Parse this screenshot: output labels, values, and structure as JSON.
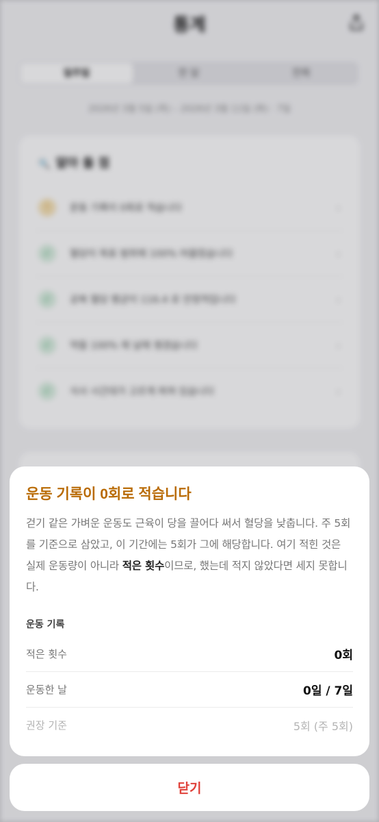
{
  "background": {
    "title": "통계",
    "tabs": [
      "일주일",
      "한 달",
      "전체"
    ],
    "date_range": "2026년 3월 5일 (목) – 2026년 3월 11일 (화) · 7일",
    "card_title": "알아 둘 점",
    "items": [
      {
        "icon": "warning-icon",
        "text": "운동 기록이 0회로 적습니다"
      },
      {
        "icon": "check-icon",
        "text": "혈당이 목표 범위에 100% 머물렀습니다"
      },
      {
        "icon": "check-icon",
        "text": "공복 혈당 평균이 116.4 로 안정적입니다"
      },
      {
        "icon": "check-icon",
        "text": "약을 100% 제 날에 챙겼습니다"
      },
      {
        "icon": "check-icon",
        "text": "식사 시간대가 고르게 퍼져 있습니다"
      }
    ]
  },
  "sheet": {
    "title": "운동 기록이 0회로 적습니다",
    "desc_before": "걷기 같은 가벼운 운동도 근육이 당을 끌어다 써서 혈당을 낮춥니다. 주 5회를 기준으로 삼았고, 이 기간에는 5회가 그에 해당합니다. 여기 적힌 것은 실제 운동량이 아니라 ",
    "desc_emphasis": "적은 횟수",
    "desc_after": "이므로, 했는데 적지 않았다면 세지 못합니다.",
    "section_label": "운동 기록",
    "stats": [
      {
        "label": "적은 횟수",
        "value": "0회"
      },
      {
        "label": "운동한 날",
        "value": "0일 / 7일"
      },
      {
        "label": "권장 기준",
        "value": "5회 (주 5회)"
      }
    ]
  },
  "close_label": "닫기",
  "colors": {
    "title_accent": "#b96b05",
    "close_red": "#e0413a"
  }
}
